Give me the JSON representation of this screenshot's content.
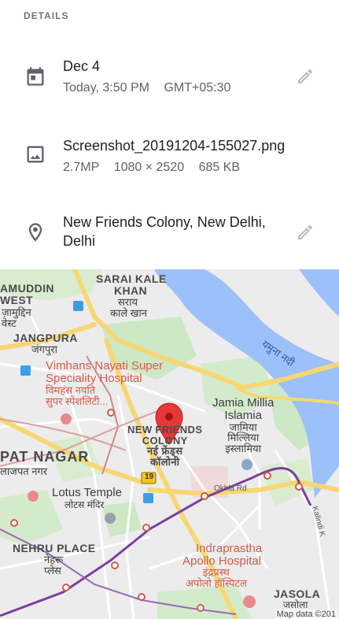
{
  "header": {
    "label": "DETAILS"
  },
  "date": {
    "icon": "calendar-icon",
    "title": "Dec 4",
    "when": "Today, 3:50 PM",
    "timezone": "GMT+05:30",
    "edit_icon": "pencil-icon"
  },
  "file": {
    "icon": "image-icon",
    "name": "Screenshot_20191204-155027.png",
    "megapixels": "2.7MP",
    "resolution": "1080 × 2520",
    "size": "685 KB"
  },
  "location": {
    "icon": "location-pin-icon",
    "line1": "New Friends Colony, New Delhi,",
    "line2": "Delhi",
    "edit_icon": "pencil-icon"
  },
  "map": {
    "labels": {
      "sarai_kale_khan_en_1": "SARAI KALE",
      "sarai_kale_khan_en_2": "KHAN",
      "sarai_kale_khan_hi_1": "सराय",
      "sarai_kale_khan_hi_2": "काले खान",
      "nizamuddin_en_1": "AMUDDIN",
      "nizamuddin_en_2": "WEST",
      "nizamuddin_hi_1": "ज़ामुद्दिन",
      "nizamuddin_hi_2": "वेस्ट",
      "jangpura_en": "JANGPURA",
      "jangpura_hi": "जंगपुरा",
      "vimhans_en_1": "Vimhans Nayati Super",
      "vimhans_en_2": "Speciality Hospital",
      "vimhans_hi_1": "विमहंस नयति",
      "vimhans_hi_2": "सुपर स्पेशलिटी...",
      "yamuna_river_hi": "यमुना नदी",
      "jamia_en_1": "Jamia Millia",
      "jamia_en_2": "Islamia",
      "jamia_hi_1": "जामिया",
      "jamia_hi_2": "मिल्लिया",
      "jamia_hi_3": "इस्लामिया",
      "nfc_en_1": "NEW FRIENDS",
      "nfc_en_2": "COLONY",
      "nfc_hi_1": "नई फ्रेंड्स",
      "nfc_hi_2": "कॉलोनी",
      "lajpat_en": "PAT NAGAR",
      "lajpat_hi": "लाजपत नगर",
      "lotus_en": "Lotus Temple",
      "lotus_hi": "लोटस मंदिर",
      "okhla_rd": "Okhla Rd",
      "kalindi": "Kalindi K",
      "nehru_en": "NEHRU PLACE",
      "nehru_hi_1": "नेहरू",
      "nehru_hi_2": "प्लेस",
      "apollo_en_1": "Indraprastha",
      "apollo_en_2": "Apollo Hospital",
      "apollo_hi_1": "इंद्रप्रस्थ",
      "apollo_hi_2": "अपोलो हॉस्पिटल",
      "jasola_en": "JASOLA",
      "jasola_hi": "जसोला",
      "route_19": "19"
    },
    "attribution": "Map data ©201"
  },
  "colors": {
    "water": "#9cc0f9",
    "road_major": "#f7d774",
    "park": "#cde8c4",
    "metro_purple": "#7b3fa0",
    "marker_red": "#e53935"
  }
}
